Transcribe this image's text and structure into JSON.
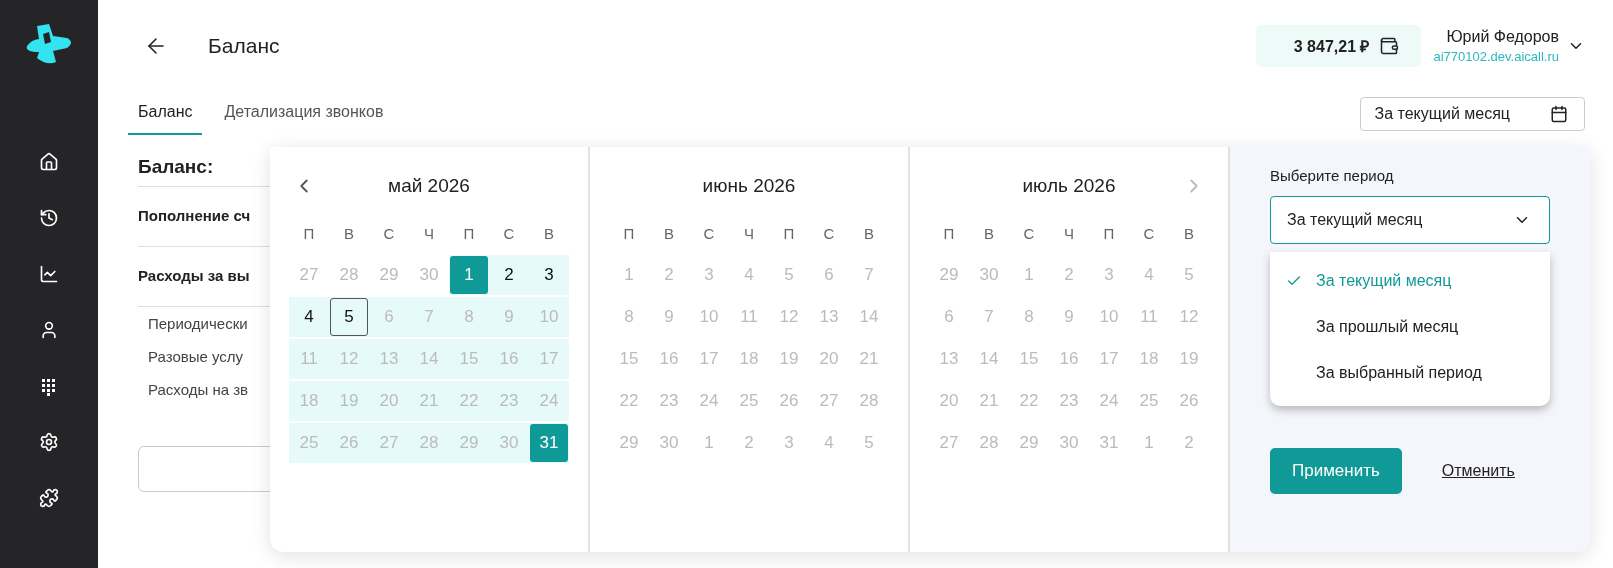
{
  "header": {
    "title": "Баланс",
    "balance": "3 847,21 ₽",
    "user_name": "Юрий Федоров",
    "user_domain": "ai770102.dev.aicall.ru"
  },
  "tabs": [
    {
      "label": "Баланс",
      "selected": true
    },
    {
      "label": "Детализация звонков",
      "selected": false
    }
  ],
  "period_button": {
    "label": "За текущий месяц"
  },
  "summary": {
    "title": "Баланс:",
    "rows": [
      {
        "label": "Пополнение сч",
        "kind": "main"
      },
      {
        "label": "Расходы за вы",
        "kind": "main"
      },
      {
        "label": "Периодически",
        "kind": "sub"
      },
      {
        "label": "Разовые услу",
        "kind": "sub"
      },
      {
        "label": "Расходы на зв",
        "kind": "sub"
      }
    ]
  },
  "calendar": {
    "months": [
      {
        "title": "май 2026",
        "weekdays": [
          "П",
          "В",
          "С",
          "Ч",
          "П",
          "С",
          "В"
        ],
        "weeks": [
          [
            {
              "text": "27",
              "muted": true,
              "in_range": false,
              "selected": false,
              "today": false
            },
            {
              "text": "28",
              "muted": true,
              "in_range": false,
              "selected": false,
              "today": false
            },
            {
              "text": "29",
              "muted": true,
              "in_range": false,
              "selected": false,
              "today": false
            },
            {
              "text": "30",
              "muted": true,
              "in_range": false,
              "selected": false,
              "today": false
            },
            {
              "text": "1",
              "muted": false,
              "in_range": true,
              "selected": true,
              "today": false
            },
            {
              "text": "2",
              "muted": false,
              "in_range": true,
              "selected": false,
              "today": false
            },
            {
              "text": "3",
              "muted": false,
              "in_range": true,
              "selected": false,
              "today": false
            }
          ],
          [
            {
              "text": "4",
              "muted": false,
              "in_range": true,
              "selected": false,
              "today": false
            },
            {
              "text": "5",
              "muted": false,
              "in_range": true,
              "selected": false,
              "today": true
            },
            {
              "text": "6",
              "muted": true,
              "in_range": true,
              "selected": false,
              "today": false
            },
            {
              "text": "7",
              "muted": true,
              "in_range": true,
              "selected": false,
              "today": false
            },
            {
              "text": "8",
              "muted": true,
              "in_range": true,
              "selected": false,
              "today": false
            },
            {
              "text": "9",
              "muted": true,
              "in_range": true,
              "selected": false,
              "today": false
            },
            {
              "text": "10",
              "muted": true,
              "in_range": true,
              "selected": false,
              "today": false
            }
          ],
          [
            {
              "text": "11",
              "muted": true,
              "in_range": true,
              "selected": false,
              "today": false
            },
            {
              "text": "12",
              "muted": true,
              "in_range": true,
              "selected": false,
              "today": false
            },
            {
              "text": "13",
              "muted": true,
              "in_range": true,
              "selected": false,
              "today": false
            },
            {
              "text": "14",
              "muted": true,
              "in_range": true,
              "selected": false,
              "today": false
            },
            {
              "text": "15",
              "muted": true,
              "in_range": true,
              "selected": false,
              "today": false
            },
            {
              "text": "16",
              "muted": true,
              "in_range": true,
              "selected": false,
              "today": false
            },
            {
              "text": "17",
              "muted": true,
              "in_range": true,
              "selected": false,
              "today": false
            }
          ],
          [
            {
              "text": "18",
              "muted": true,
              "in_range": true,
              "selected": false,
              "today": false
            },
            {
              "text": "19",
              "muted": true,
              "in_range": true,
              "selected": false,
              "today": false
            },
            {
              "text": "20",
              "muted": true,
              "in_range": true,
              "selected": false,
              "today": false
            },
            {
              "text": "21",
              "muted": true,
              "in_range": true,
              "selected": false,
              "today": false
            },
            {
              "text": "22",
              "muted": true,
              "in_range": true,
              "selected": false,
              "today": false
            },
            {
              "text": "23",
              "muted": true,
              "in_range": true,
              "selected": false,
              "today": false
            },
            {
              "text": "24",
              "muted": true,
              "in_range": true,
              "selected": false,
              "today": false
            }
          ],
          [
            {
              "text": "25",
              "muted": true,
              "in_range": true,
              "selected": false,
              "today": false
            },
            {
              "text": "26",
              "muted": true,
              "in_range": true,
              "selected": false,
              "today": false
            },
            {
              "text": "27",
              "muted": true,
              "in_range": true,
              "selected": false,
              "today": false
            },
            {
              "text": "28",
              "muted": true,
              "in_range": true,
              "selected": false,
              "today": false
            },
            {
              "text": "29",
              "muted": true,
              "in_range": true,
              "selected": false,
              "today": false
            },
            {
              "text": "30",
              "muted": true,
              "in_range": true,
              "selected": false,
              "today": false
            },
            {
              "text": "31",
              "muted": false,
              "in_range": true,
              "selected": true,
              "today": false
            }
          ]
        ]
      },
      {
        "title": "июнь 2026",
        "weekdays": [
          "П",
          "В",
          "С",
          "Ч",
          "П",
          "С",
          "В"
        ],
        "weeks": [
          [
            {
              "text": "1",
              "muted": true,
              "in_range": false,
              "selected": false,
              "today": false
            },
            {
              "text": "2",
              "muted": true,
              "in_range": false,
              "selected": false,
              "today": false
            },
            {
              "text": "3",
              "muted": true,
              "in_range": false,
              "selected": false,
              "today": false
            },
            {
              "text": "4",
              "muted": true,
              "in_range": false,
              "selected": false,
              "today": false
            },
            {
              "text": "5",
              "muted": true,
              "in_range": false,
              "selected": false,
              "today": false
            },
            {
              "text": "6",
              "muted": true,
              "in_range": false,
              "selected": false,
              "today": false
            },
            {
              "text": "7",
              "muted": true,
              "in_range": false,
              "selected": false,
              "today": false
            }
          ],
          [
            {
              "text": "8",
              "muted": true,
              "in_range": false,
              "selected": false,
              "today": false
            },
            {
              "text": "9",
              "muted": true,
              "in_range": false,
              "selected": false,
              "today": false
            },
            {
              "text": "10",
              "muted": true,
              "in_range": false,
              "selected": false,
              "today": false
            },
            {
              "text": "11",
              "muted": true,
              "in_range": false,
              "selected": false,
              "today": false
            },
            {
              "text": "12",
              "muted": true,
              "in_range": false,
              "selected": false,
              "today": false
            },
            {
              "text": "13",
              "muted": true,
              "in_range": false,
              "selected": false,
              "today": false
            },
            {
              "text": "14",
              "muted": true,
              "in_range": false,
              "selected": false,
              "today": false
            }
          ],
          [
            {
              "text": "15",
              "muted": true,
              "in_range": false,
              "selected": false,
              "today": false
            },
            {
              "text": "16",
              "muted": true,
              "in_range": false,
              "selected": false,
              "today": false
            },
            {
              "text": "17",
              "muted": true,
              "in_range": false,
              "selected": false,
              "today": false
            },
            {
              "text": "18",
              "muted": true,
              "in_range": false,
              "selected": false,
              "today": false
            },
            {
              "text": "19",
              "muted": true,
              "in_range": false,
              "selected": false,
              "today": false
            },
            {
              "text": "20",
              "muted": true,
              "in_range": false,
              "selected": false,
              "today": false
            },
            {
              "text": "21",
              "muted": true,
              "in_range": false,
              "selected": false,
              "today": false
            }
          ],
          [
            {
              "text": "22",
              "muted": true,
              "in_range": false,
              "selected": false,
              "today": false
            },
            {
              "text": "23",
              "muted": true,
              "in_range": false,
              "selected": false,
              "today": false
            },
            {
              "text": "24",
              "muted": true,
              "in_range": false,
              "selected": false,
              "today": false
            },
            {
              "text": "25",
              "muted": true,
              "in_range": false,
              "selected": false,
              "today": false
            },
            {
              "text": "26",
              "muted": true,
              "in_range": false,
              "selected": false,
              "today": false
            },
            {
              "text": "27",
              "muted": true,
              "in_range": false,
              "selected": false,
              "today": false
            },
            {
              "text": "28",
              "muted": true,
              "in_range": false,
              "selected": false,
              "today": false
            }
          ],
          [
            {
              "text": "29",
              "muted": true,
              "in_range": false,
              "selected": false,
              "today": false
            },
            {
              "text": "30",
              "muted": true,
              "in_range": false,
              "selected": false,
              "today": false
            },
            {
              "text": "1",
              "muted": true,
              "in_range": false,
              "selected": false,
              "today": false
            },
            {
              "text": "2",
              "muted": true,
              "in_range": false,
              "selected": false,
              "today": false
            },
            {
              "text": "3",
              "muted": true,
              "in_range": false,
              "selected": false,
              "today": false
            },
            {
              "text": "4",
              "muted": true,
              "in_range": false,
              "selected": false,
              "today": false
            },
            {
              "text": "5",
              "muted": true,
              "in_range": false,
              "selected": false,
              "today": false
            }
          ]
        ]
      },
      {
        "title": "июль 2026",
        "weekdays": [
          "П",
          "В",
          "С",
          "Ч",
          "П",
          "С",
          "В"
        ],
        "weeks": [
          [
            {
              "text": "29",
              "muted": true,
              "in_range": false,
              "selected": false,
              "today": false
            },
            {
              "text": "30",
              "muted": true,
              "in_range": false,
              "selected": false,
              "today": false
            },
            {
              "text": "1",
              "muted": true,
              "in_range": false,
              "selected": false,
              "today": false
            },
            {
              "text": "2",
              "muted": true,
              "in_range": false,
              "selected": false,
              "today": false
            },
            {
              "text": "3",
              "muted": true,
              "in_range": false,
              "selected": false,
              "today": false
            },
            {
              "text": "4",
              "muted": true,
              "in_range": false,
              "selected": false,
              "today": false
            },
            {
              "text": "5",
              "muted": true,
              "in_range": false,
              "selected": false,
              "today": false
            }
          ],
          [
            {
              "text": "6",
              "muted": true,
              "in_range": false,
              "selected": false,
              "today": false
            },
            {
              "text": "7",
              "muted": true,
              "in_range": false,
              "selected": false,
              "today": false
            },
            {
              "text": "8",
              "muted": true,
              "in_range": false,
              "selected": false,
              "today": false
            },
            {
              "text": "9",
              "muted": true,
              "in_range": false,
              "selected": false,
              "today": false
            },
            {
              "text": "10",
              "muted": true,
              "in_range": false,
              "selected": false,
              "today": false
            },
            {
              "text": "11",
              "muted": true,
              "in_range": false,
              "selected": false,
              "today": false
            },
            {
              "text": "12",
              "muted": true,
              "in_range": false,
              "selected": false,
              "today": false
            }
          ],
          [
            {
              "text": "13",
              "muted": true,
              "in_range": false,
              "selected": false,
              "today": false
            },
            {
              "text": "14",
              "muted": true,
              "in_range": false,
              "selected": false,
              "today": false
            },
            {
              "text": "15",
              "muted": true,
              "in_range": false,
              "selected": false,
              "today": false
            },
            {
              "text": "16",
              "muted": true,
              "in_range": false,
              "selected": false,
              "today": false
            },
            {
              "text": "17",
              "muted": true,
              "in_range": false,
              "selected": false,
              "today": false
            },
            {
              "text": "18",
              "muted": true,
              "in_range": false,
              "selected": false,
              "today": false
            },
            {
              "text": "19",
              "muted": true,
              "in_range": false,
              "selected": false,
              "today": false
            }
          ],
          [
            {
              "text": "20",
              "muted": true,
              "in_range": false,
              "selected": false,
              "today": false
            },
            {
              "text": "21",
              "muted": true,
              "in_range": false,
              "selected": false,
              "today": false
            },
            {
              "text": "22",
              "muted": true,
              "in_range": false,
              "selected": false,
              "today": false
            },
            {
              "text": "23",
              "muted": true,
              "in_range": false,
              "selected": false,
              "today": false
            },
            {
              "text": "24",
              "muted": true,
              "in_range": false,
              "selected": false,
              "today": false
            },
            {
              "text": "25",
              "muted": true,
              "in_range": false,
              "selected": false,
              "today": false
            },
            {
              "text": "26",
              "muted": true,
              "in_range": false,
              "selected": false,
              "today": false
            }
          ],
          [
            {
              "text": "27",
              "muted": true,
              "in_range": false,
              "selected": false,
              "today": false
            },
            {
              "text": "28",
              "muted": true,
              "in_range": false,
              "selected": false,
              "today": false
            },
            {
              "text": "29",
              "muted": true,
              "in_range": false,
              "selected": false,
              "today": false
            },
            {
              "text": "30",
              "muted": true,
              "in_range": false,
              "selected": false,
              "today": false
            },
            {
              "text": "31",
              "muted": true,
              "in_range": false,
              "selected": false,
              "today": false
            },
            {
              "text": "1",
              "muted": true,
              "in_range": false,
              "selected": false,
              "today": false
            },
            {
              "text": "2",
              "muted": true,
              "in_range": false,
              "selected": false,
              "today": false
            }
          ]
        ]
      }
    ],
    "period_label": "Выберите период",
    "select_value": "За текущий месяц",
    "options": [
      {
        "label": "За текущий месяц",
        "selected": true
      },
      {
        "label": "За прошлый месяц",
        "selected": false
      },
      {
        "label": "За выбранный период",
        "selected": false
      }
    ],
    "apply": "Применить",
    "cancel": "Отменить"
  }
}
